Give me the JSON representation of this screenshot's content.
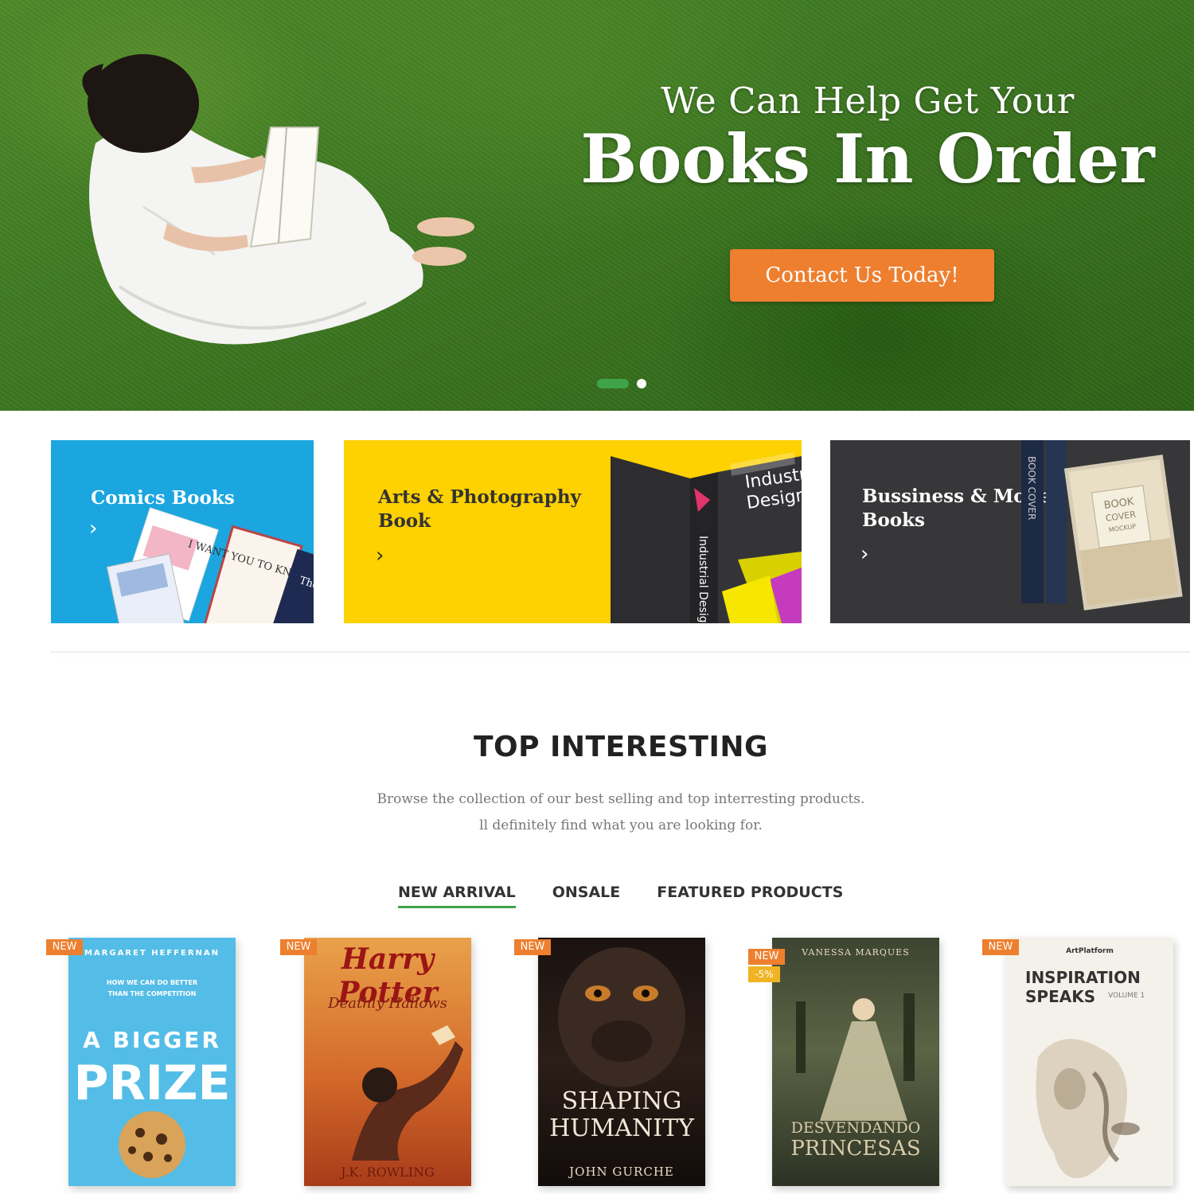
{
  "hero": {
    "subtitle": "We Can Help Get Your",
    "title": "Books In Order",
    "cta_label": "Contact Us Today!"
  },
  "categories": [
    {
      "label": "Comics Books",
      "color": "#1ba6e0"
    },
    {
      "label_line1": "Arts & Photography",
      "label_line2": "Book",
      "color": "#fed100",
      "cover_text_1": "Industrial",
      "cover_text_2": "Design",
      "spine_text": "Industrial Design"
    },
    {
      "label_line1": "Bussiness & Money",
      "label_line2": "Books",
      "color": "#373739",
      "cover_text_1": "BOOK",
      "cover_text_2": "COVER",
      "cover_text_3": "MOCKUP",
      "spine_text": "BOOK COVER"
    }
  ],
  "comics_covers": {
    "c1": "I WANT YOU TO KNOW ME",
    "c2": "The Di War"
  },
  "section": {
    "title": "TOP INTERESTING",
    "desc_line1": "Browse the collection of our best selling and top interresting products.",
    "desc_line2": "ll definitely find what you are looking for."
  },
  "tabs": [
    {
      "label": "NEW ARRIVAL",
      "active": true
    },
    {
      "label": "ONSALE",
      "active": false
    },
    {
      "label": "FEATURED PRODUCTS",
      "active": false
    }
  ],
  "products": [
    {
      "badge": "NEW",
      "author": "MARGARET HEFFERNAN",
      "tagline": "HOW WE CAN DO BETTER THAN THE COMPETITION",
      "title1": "A BIGGER",
      "title2": "PRIZE"
    },
    {
      "badge": "NEW",
      "title1": "Harry Potter",
      "title2": "Deathly Hallows",
      "author": "J.K. ROWLING"
    },
    {
      "badge": "NEW",
      "title1": "SHAPING",
      "title2": "HUMANITY",
      "author": "JOHN GURCHE"
    },
    {
      "badge": "NEW",
      "sale": "-5%",
      "author": "VANESSA MARQUES",
      "title1": "DESVENDANDO",
      "title2": "PRINCESAS"
    },
    {
      "badge": "NEW",
      "publisher": "ArtPlatform",
      "title1": "INSPIRATION",
      "title2": "SPEAKS",
      "volume": "VOLUME 1"
    }
  ],
  "colors": {
    "accent": "#ed7f2f",
    "green": "#3fa34a"
  }
}
